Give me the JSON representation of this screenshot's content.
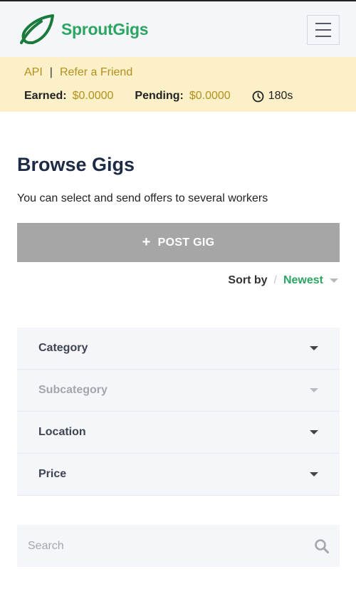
{
  "header": {
    "brand": "SproutGigs",
    "logo_icon": "leaf-icon",
    "menu_icon": "hamburger-icon"
  },
  "infobar": {
    "links": [
      "API",
      "Refer a Friend"
    ],
    "separator": "|",
    "earned_label": "Earned:",
    "earned_value": "$0.0000",
    "pending_label": "Pending:",
    "pending_value": "$0.0000",
    "timer_icon": "clock-icon",
    "timer_value": "180s"
  },
  "main": {
    "title": "Browse Gigs",
    "subtitle": "You can select and send offers to several workers",
    "post_button": "POST GIG",
    "post_icon": "+",
    "sort_label": "Sort by",
    "sort_separator": "/",
    "sort_value": "Newest"
  },
  "filters": [
    {
      "label": "Category",
      "enabled": true
    },
    {
      "label": "Subcategory",
      "enabled": false
    },
    {
      "label": "Location",
      "enabled": true
    },
    {
      "label": "Price",
      "enabled": true
    }
  ],
  "search": {
    "placeholder": "Search",
    "icon": "search-icon"
  },
  "colors": {
    "brand_green": "#2da562",
    "gold": "#b2901b",
    "infobar_bg": "#fcf0c8",
    "button_gray": "#a6a6a6"
  }
}
